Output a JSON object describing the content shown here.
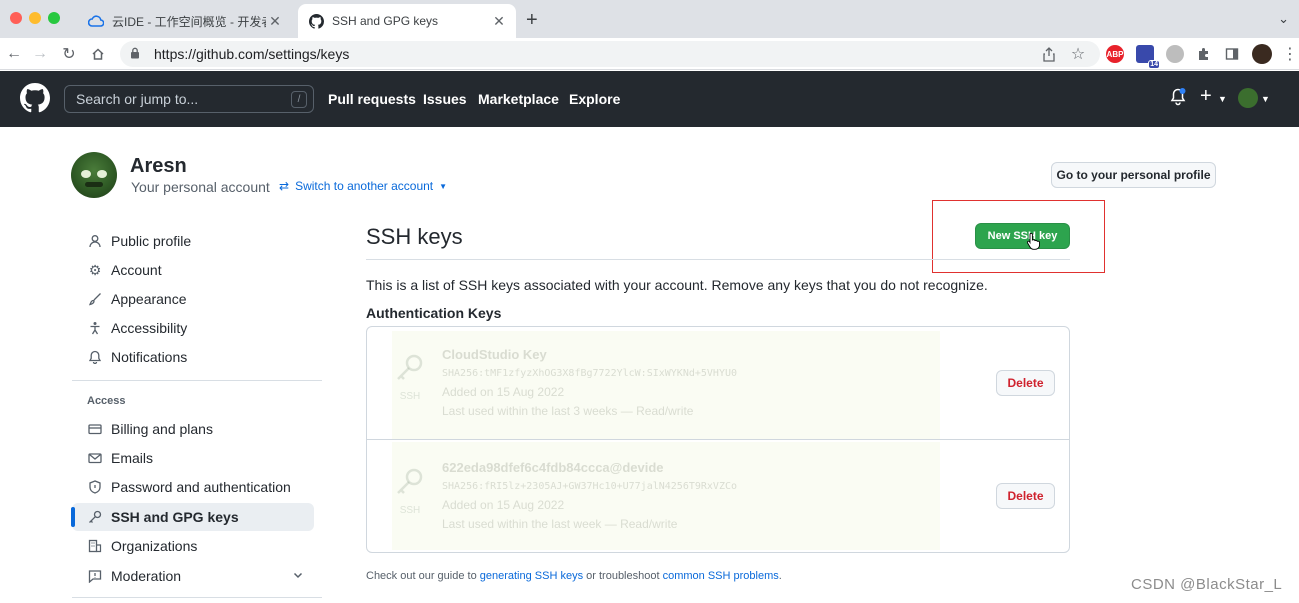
{
  "browser": {
    "tabs": [
      {
        "title": "云IDE - 工作空间概览 - 开发者云",
        "active": false
      },
      {
        "title": "SSH and GPG keys",
        "active": true
      }
    ],
    "url": "https://github.com/settings/keys",
    "ext_abp": "ABP",
    "ext_badge": "14"
  },
  "header": {
    "search_placeholder": "Search or jump to...",
    "search_shortcut": "/",
    "nav": [
      "Pull requests",
      "Issues",
      "Marketplace",
      "Explore"
    ]
  },
  "account": {
    "name": "Aresn",
    "subtitle": "Your personal account",
    "switch_label": "Switch to another account",
    "profile_button": "Go to your personal profile"
  },
  "sidebar": {
    "items": [
      {
        "label": "Public profile",
        "icon": "person-icon"
      },
      {
        "label": "Account",
        "icon": "gear-icon"
      },
      {
        "label": "Appearance",
        "icon": "paintbrush-icon"
      },
      {
        "label": "Accessibility",
        "icon": "accessibility-icon"
      },
      {
        "label": "Notifications",
        "icon": "bell-icon"
      }
    ],
    "access_heading": "Access",
    "access_items": [
      {
        "label": "Billing and plans",
        "icon": "credit-card-icon"
      },
      {
        "label": "Emails",
        "icon": "mail-icon"
      },
      {
        "label": "Password and authentication",
        "icon": "shield-icon"
      },
      {
        "label": "SSH and GPG keys",
        "icon": "key-icon",
        "selected": true
      },
      {
        "label": "Organizations",
        "icon": "organization-icon"
      },
      {
        "label": "Moderation",
        "icon": "report-icon"
      }
    ]
  },
  "main": {
    "title": "SSH keys",
    "new_key_button": "New SSH key",
    "description": "This is a list of SSH keys associated with your account. Remove any keys that you do not recognize.",
    "auth_heading": "Authentication Keys",
    "keys": [
      {
        "title": "CloudStudio Key",
        "fingerprint": "SHA256:tMF1zfyzXhOG3X8fBg7722YlcW:SIxWYKNd+5VHYU0",
        "added": "Added on 15 Aug 2022",
        "last_used": "Last used within the last 3 weeks — Read/write",
        "tag": "SSH",
        "delete_label": "Delete"
      },
      {
        "title": "622eda98dfef6c4fdb84ccca@devide",
        "fingerprint": "SHA256:fRI5lz+2305AJ+GW37Hc10+U77jalN4256T9RxVZCo",
        "added": "Added on 15 Aug 2022",
        "last_used": "Last used within the last week — Read/write",
        "tag": "SSH",
        "delete_label": "Delete"
      }
    ],
    "footer_prefix": "Check out our guide to ",
    "footer_link1": "generating SSH keys",
    "footer_middle": " or troubleshoot ",
    "footer_link2": "common SSH problems",
    "footer_suffix": "."
  },
  "watermark": "CSDN @BlackStar_L"
}
